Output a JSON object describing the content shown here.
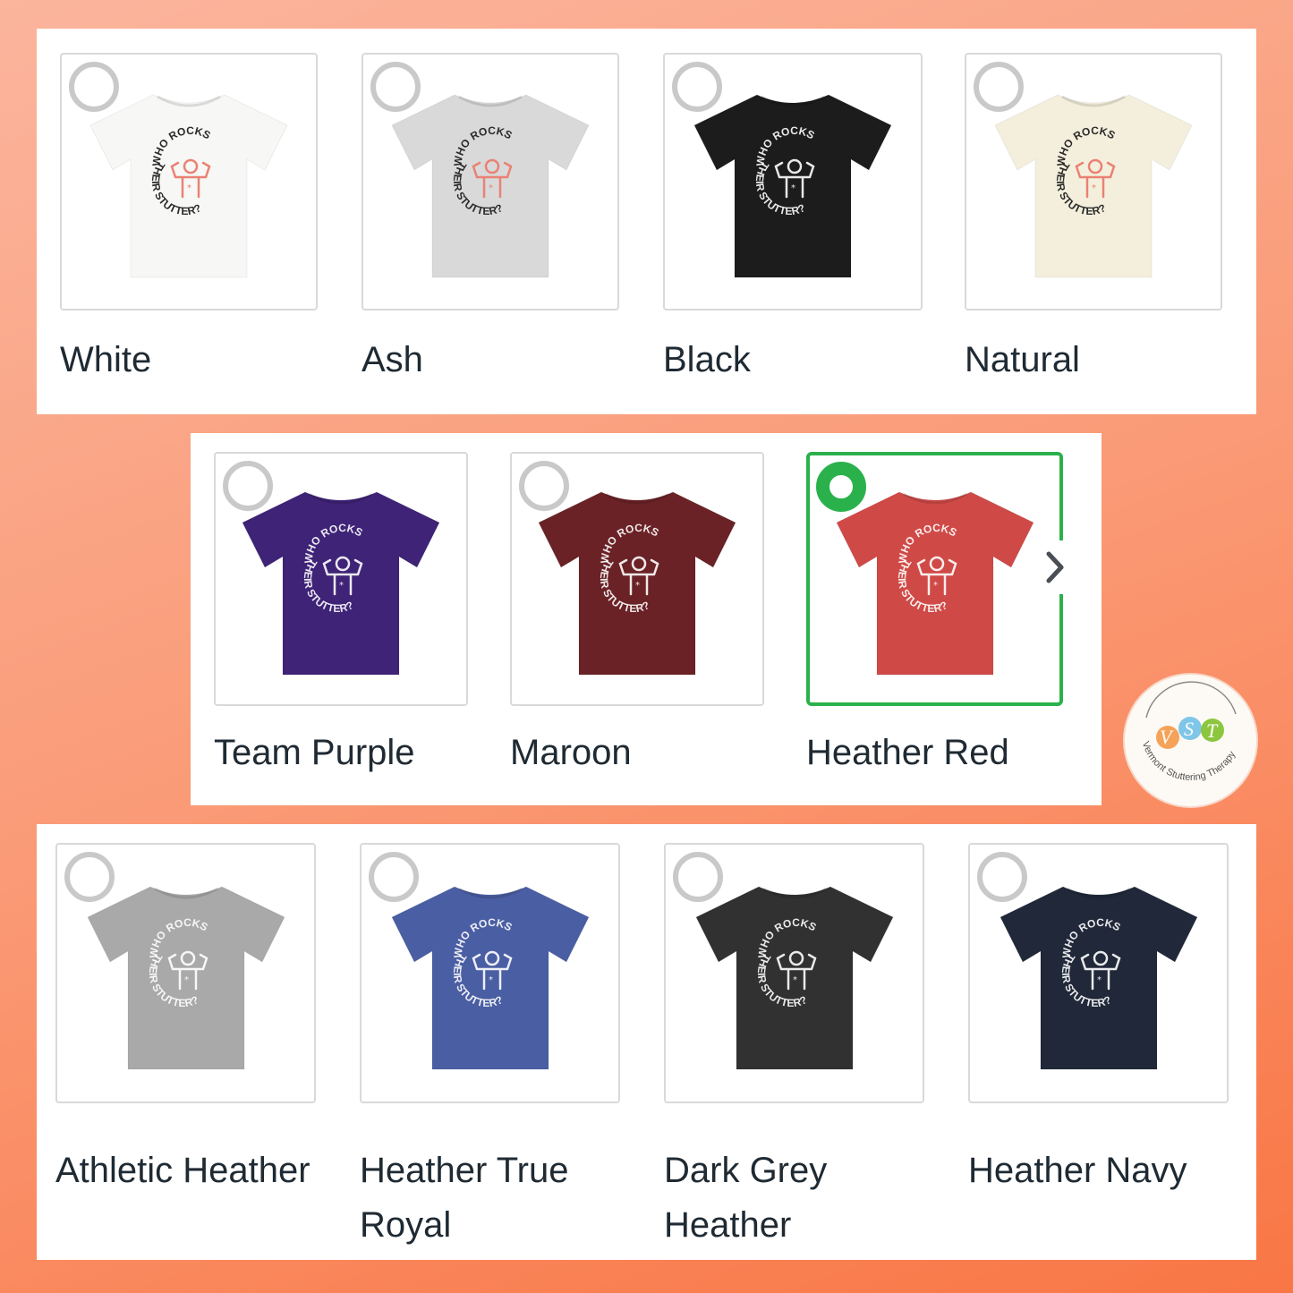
{
  "colors": {
    "selected_accent": "#2bb14c",
    "radio_idle": "#c9c9c9",
    "label_text": "#1f2a33"
  },
  "design_text": {
    "top": "WHO ROCKS",
    "bottom": "THEIR STUTTER?"
  },
  "swatches": [
    {
      "label": "White",
      "shirt_color": "#f7f7f5",
      "ink": "dark",
      "selected": false
    },
    {
      "label": "Ash",
      "shirt_color": "#d9d9d9",
      "ink": "dark",
      "selected": false
    },
    {
      "label": "Black",
      "shirt_color": "#1c1c1c",
      "ink": "light",
      "selected": false
    },
    {
      "label": "Natural",
      "shirt_color": "#f4efdc",
      "ink": "dark",
      "selected": false
    },
    {
      "label": "Team Purple",
      "shirt_color": "#3e2377",
      "ink": "light",
      "selected": false
    },
    {
      "label": "Maroon",
      "shirt_color": "#6a2226",
      "ink": "light",
      "selected": false
    },
    {
      "label": "Heather Red",
      "shirt_color": "#cf4a47",
      "ink": "light",
      "selected": true
    },
    {
      "label": "Athletic Heather",
      "shirt_color": "#a9a9a9",
      "ink": "light",
      "selected": false
    },
    {
      "label": "Heather True Royal",
      "shirt_color": "#4a5ea3",
      "ink": "light",
      "selected": false
    },
    {
      "label": "Dark Grey Heather",
      "shirt_color": "#313131",
      "ink": "light",
      "selected": false
    },
    {
      "label": "Heather Navy",
      "shirt_color": "#202839",
      "ink": "light",
      "selected": false
    }
  ],
  "carousel": {
    "next_icon": "chevron-right-icon"
  },
  "logo": {
    "letters": "VST",
    "caption": "Vermont Stuttering Therapy"
  }
}
